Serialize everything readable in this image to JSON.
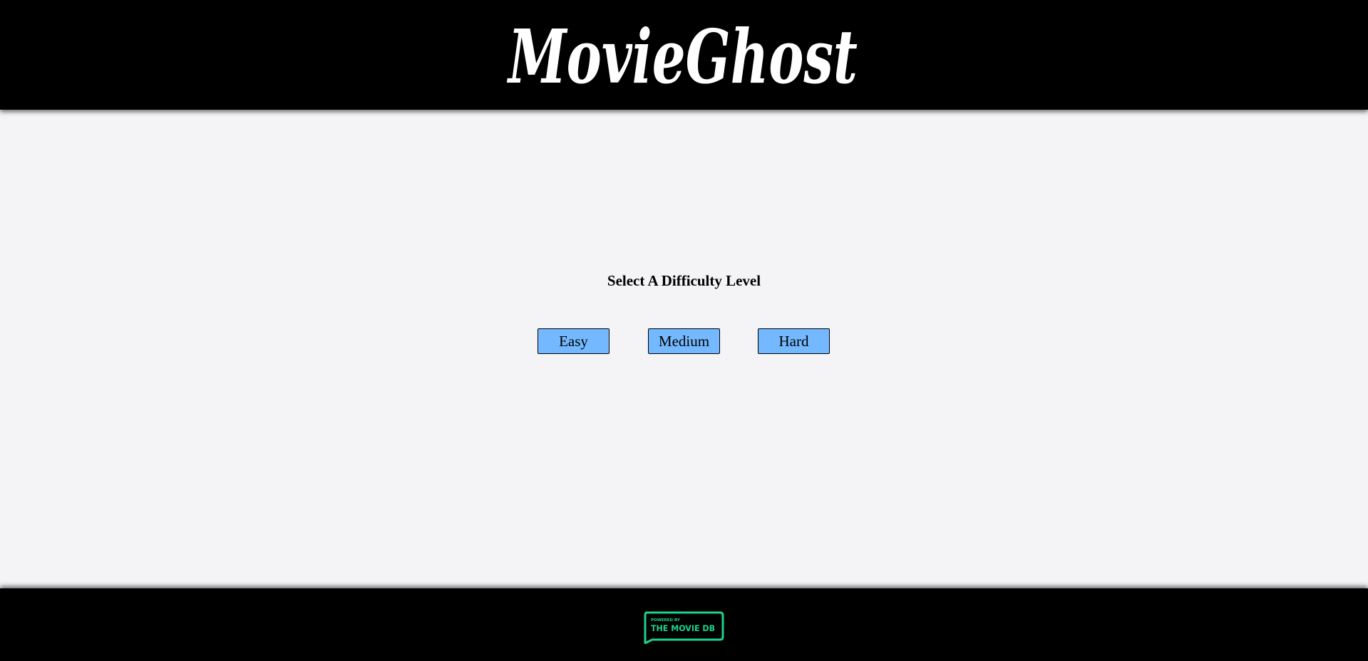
{
  "header": {
    "logo_text": "MovieGhost"
  },
  "main": {
    "prompt": "Select A Difficulty Level",
    "buttons": [
      {
        "label": "Easy"
      },
      {
        "label": "Medium"
      },
      {
        "label": "Hard"
      }
    ],
    "button_color": "#74b9ff"
  },
  "footer": {
    "badge": {
      "line1": "POWERED BY",
      "line2": "THE MOVIE DB",
      "color": "#1ed28a"
    }
  }
}
